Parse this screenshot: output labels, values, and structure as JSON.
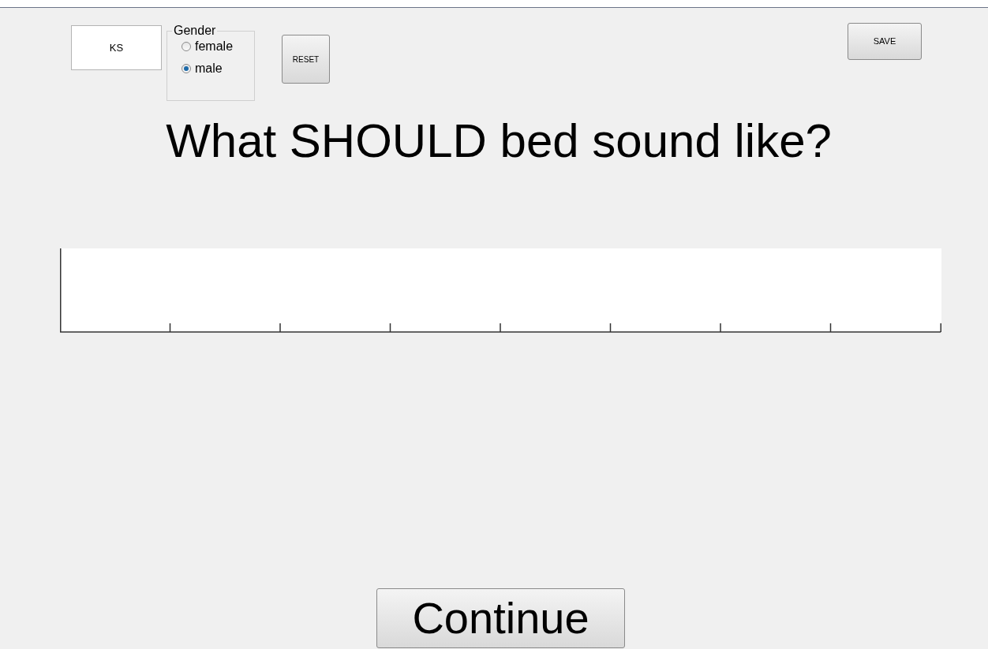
{
  "initials_field": {
    "value": "KS"
  },
  "gender": {
    "label": "Gender",
    "options": [
      {
        "label": "female",
        "selected": false
      },
      {
        "label": "male",
        "selected": true
      }
    ]
  },
  "reset_button": "RESET",
  "save_button": "SAVE",
  "question": "What SHOULD bed sound like?",
  "continue_button": "Continue"
}
